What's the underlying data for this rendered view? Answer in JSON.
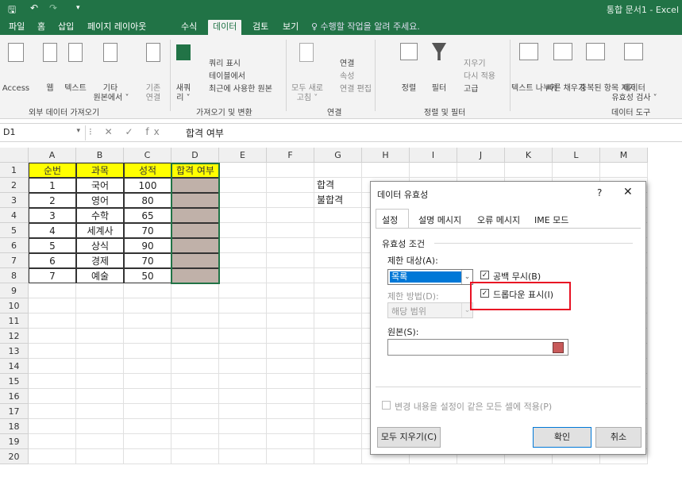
{
  "title_bar": {
    "save_icon": "save-icon",
    "undo_icon": "undo-icon",
    "redo_icon": "redo-icon",
    "customize_icon": "customize-qat-icon",
    "doc_title": "통합 문서1 - Excel"
  },
  "tabs": [
    {
      "label": "파일"
    },
    {
      "label": "홈"
    },
    {
      "label": "삽입"
    },
    {
      "label": "페이지 레이아웃"
    },
    {
      "label": "수식"
    },
    {
      "label": "데이터",
      "active": true
    },
    {
      "label": "검토"
    },
    {
      "label": "보기"
    }
  ],
  "tell_me": "♀ 수행할 작업을 알려 주세요.",
  "ribbon": {
    "access": "Access",
    "web": "웹",
    "text": "텍스트",
    "other_l1": "기타",
    "other_l2": "원본에서 ˅",
    "existing_l1": "기존",
    "existing_l2": "연결",
    "new_query_l1": "새쿼",
    "new_query_l2": "리 ˅",
    "show_queries": "쿼리 표시",
    "from_table": "테이블에서",
    "recent_sources": "최근에 사용한 원본",
    "refresh_l1": "모두 새로",
    "refresh_l2": "고침 ˅",
    "connections": "연결",
    "properties": "속성",
    "edit_links": "연결 편집",
    "sort": "정렬",
    "filter": "필터",
    "clear": "지우기",
    "reapply": "다시 적용",
    "advanced": "고급",
    "text_to_columns": "텍스트 나누기",
    "flash_fill": "빠른 채우기",
    "remove_duplicates": "중복된 항목 제거",
    "data_validation_l1": "데이터",
    "data_validation_l2": "유효성 검사 ˅",
    "groups": {
      "external": "외부 데이터 가져오기",
      "get_transform": "가져오기 및 변환",
      "connections": "연결",
      "sort_filter": "정렬 및 필터",
      "data_tools": "데이터 도구"
    }
  },
  "formula_bar": {
    "name_box": "D1",
    "fx_symbols": "⁝ ✕ ✓ fx",
    "formula": "합격 여부"
  },
  "grid": {
    "columns": [
      "A",
      "B",
      "C",
      "D",
      "E",
      "F",
      "G",
      "H",
      "I",
      "J",
      "K",
      "L",
      "M"
    ],
    "rows": [
      "1",
      "2",
      "3",
      "4",
      "5",
      "6",
      "7",
      "8",
      "9",
      "10",
      "11",
      "12",
      "13",
      "14",
      "15",
      "16",
      "17",
      "18",
      "19",
      "20"
    ],
    "headers": [
      "순번",
      "과목",
      "성적",
      "합격 여부"
    ],
    "data": [
      [
        "1",
        "국어",
        "100"
      ],
      [
        "2",
        "영어",
        "80"
      ],
      [
        "3",
        "수학",
        "65"
      ],
      [
        "4",
        "세계사",
        "70"
      ],
      [
        "5",
        "상식",
        "90"
      ],
      [
        "6",
        "경제",
        "70"
      ],
      [
        "7",
        "예술",
        "50"
      ]
    ],
    "g2": "합격",
    "g3": "불합격"
  },
  "dialog": {
    "title": "데이터 유효성",
    "help": "?",
    "close": "✕",
    "tabs": [
      "설정",
      "설명 메시지",
      "오류 메시지",
      "IME 모드"
    ],
    "section": "유효성 조건",
    "allow_label": "제한 대상(A):",
    "allow_value": "목록",
    "ignore_blank": "공백 무시(B)",
    "in_cell_dropdown": "드롭다운 표시(I)",
    "data_label": "제한 방법(D):",
    "data_value": "해당 범위",
    "source_label": "원본(S):",
    "apply_all": "변경 내용을 설정이 같은 모든 셀에 적용(P)",
    "clear_all": "모두 지우기(C)",
    "ok": "확인",
    "cancel": "취소"
  },
  "colors": {
    "excel_green": "#217346",
    "header_yellow": "#ffff00",
    "shaded": "#c0b1a9",
    "highlight_red": "#e81123"
  }
}
